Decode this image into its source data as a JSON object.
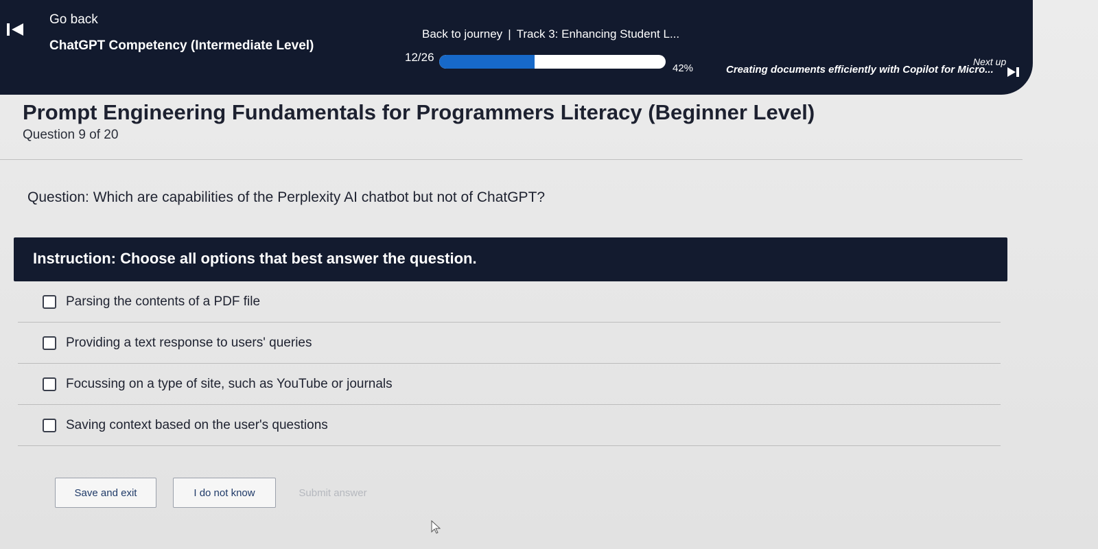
{
  "header": {
    "go_back_label": "Go back",
    "course_title": "ChatGPT Competency (Intermediate Level)",
    "back_to_journey_label": "Back to journey",
    "separator": "|",
    "track_label": "Track 3: Enhancing Student L...",
    "progress_text": "12/26",
    "progress_percent_text": "42%",
    "progress_fraction": 0.42,
    "next_up_label": "Next up",
    "next_title": "Creating documents efficiently with Copilot for Micro..."
  },
  "main": {
    "page_title": "Prompt Engineering Fundamentals for Programmers Literacy (Beginner Level)",
    "question_count": "Question 9 of 20",
    "question_text": "Question: Which are capabilities of the Perplexity AI chatbot but not of ChatGPT?",
    "instruction_text": "Instruction: Choose all options that best answer the question.",
    "options": [
      "Parsing the contents of a PDF file",
      "Providing a text response to users' queries",
      "Focussing on a type of site, such as YouTube or journals",
      "Saving context based on the user's questions"
    ]
  },
  "actions": {
    "save_label": "Save and exit",
    "idk_label": "I do not know",
    "submit_label": "Submit answer"
  },
  "colors": {
    "nav_bg": "#121a2e",
    "progress_fill": "#1769c9",
    "instruction_bg": "#131b2f",
    "button_text": "#1f3a68",
    "disabled_text": "#b5b8be"
  },
  "icons": {
    "prev": "skip-previous-icon",
    "next": "skip-next-icon",
    "checkbox": "checkbox-empty-icon",
    "cursor": "mouse-pointer-icon"
  }
}
